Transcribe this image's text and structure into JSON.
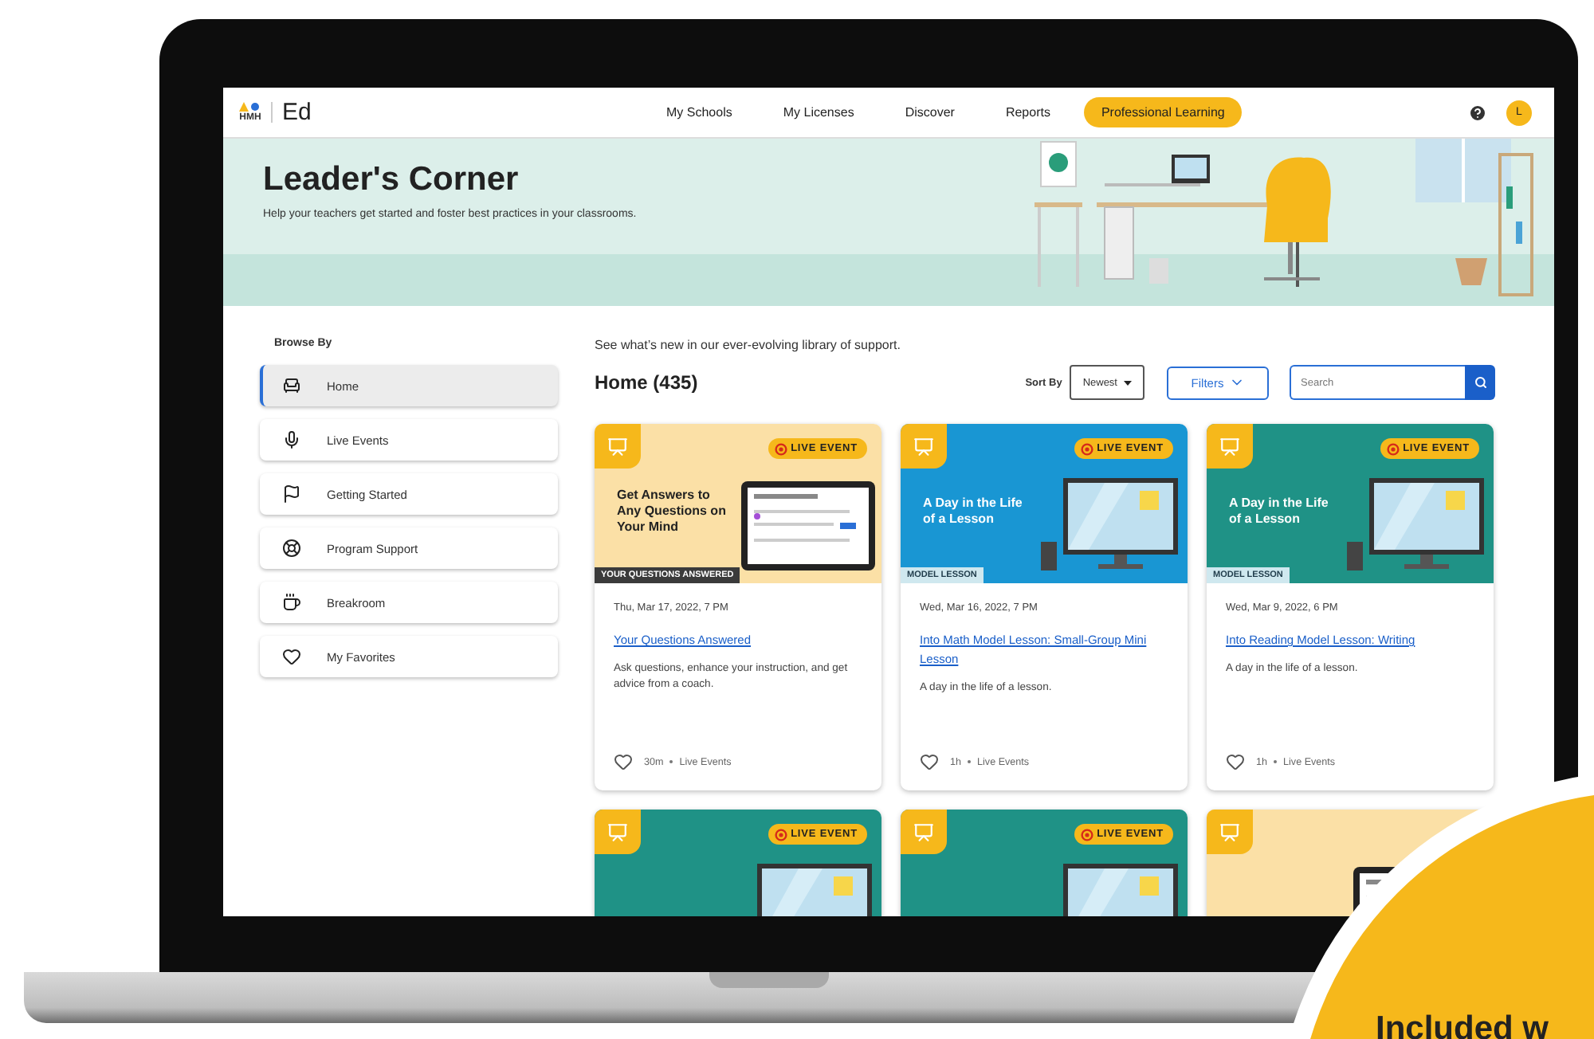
{
  "brand": {
    "logo": "HMH",
    "product": "Ed"
  },
  "nav": [
    {
      "label": "My Schools",
      "selected": false
    },
    {
      "label": "My Licenses",
      "selected": false
    },
    {
      "label": "Discover",
      "selected": false
    },
    {
      "label": "Reports",
      "selected": false
    },
    {
      "label": "Professional Learning",
      "selected": true
    }
  ],
  "user": {
    "initial": "L"
  },
  "banner": {
    "title": "Leader's Corner",
    "subtitle": "Help your teachers get started and foster best practices in your classrooms."
  },
  "sidebar": {
    "heading": "Browse By",
    "items": [
      {
        "label": "Home",
        "selected": true
      },
      {
        "label": "Live Events",
        "selected": false
      },
      {
        "label": "Getting Started",
        "selected": false
      },
      {
        "label": "Program Support",
        "selected": false
      },
      {
        "label": "Breakroom",
        "selected": false
      },
      {
        "label": "My Favorites",
        "selected": false
      }
    ]
  },
  "content": {
    "intro": "See what’s new in our ever-evolving library of support.",
    "heading": "Home (435)",
    "sort_label": "Sort By",
    "sort_value": "Newest",
    "filters": "Filters",
    "search": {
      "placeholder": "Search"
    }
  },
  "cards": [
    {
      "kind": "tablet",
      "color": "#fbe0a6",
      "badge": "LIVE EVENT",
      "headline": "Get Answers to Any Questions on Your Mind",
      "tag": "YOUR QUESTIONS ANSWERED",
      "date": "Thu, Mar 17, 2022, 7 PM",
      "title": "Your Questions Answered",
      "description": "Ask questions, enhance your instruction, and get advice from a coach.",
      "duration": "30m",
      "type": "Live Events"
    },
    {
      "kind": "monitor",
      "color": "#1996d3",
      "badge": "LIVE EVENT",
      "headline": "A Day in the Life of a Lesson",
      "tag": "MODEL LESSON",
      "date": "Wed, Mar 16, 2022, 7 PM",
      "title": "Into Math Model Lesson: Small-Group Mini Lesson",
      "description": "A day in the life of a lesson.",
      "duration": "1h",
      "type": "Live Events"
    },
    {
      "kind": "monitor",
      "color": "#1f9286",
      "badge": "LIVE EVENT",
      "headline": "A Day in the Life of a Lesson",
      "tag": "MODEL LESSON",
      "date": "Wed, Mar 9, 2022, 6 PM",
      "title": "Into Reading Model Lesson: Writing",
      "description": "A day in the life of a lesson.",
      "duration": "1h",
      "type": "Live Events"
    }
  ],
  "more_cards": [
    {
      "kind": "monitor",
      "color": "#1f9286",
      "badge": "LIVE EVENT"
    },
    {
      "kind": "monitor",
      "color": "#1f9286",
      "badge": "LIVE EVENT"
    },
    {
      "kind": "tablet",
      "color": "#fbe0a6"
    }
  ],
  "promo": {
    "text": "Included w"
  }
}
